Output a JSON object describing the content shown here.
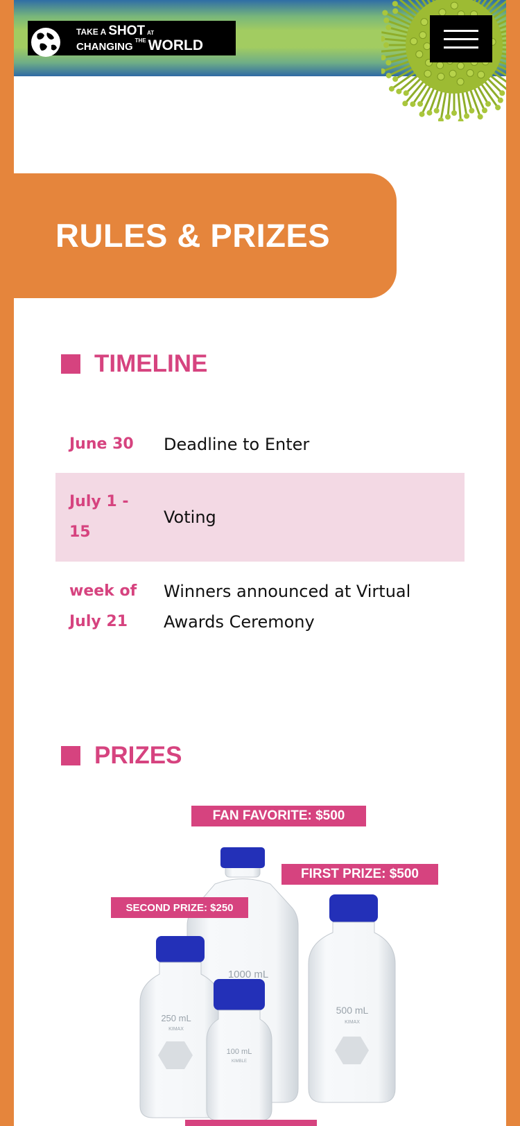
{
  "header": {
    "logo_line1_small": "TAKE A",
    "logo_line1_big": "SHOT",
    "logo_line1_tiny": "AT",
    "logo_line2_med": "CHANGING",
    "logo_line2_tiny": "THE",
    "logo_line2_big": "WORLD"
  },
  "page_title": "RULES & PRIZES",
  "timeline": {
    "heading": "TIMELINE",
    "rows": [
      {
        "date": "June 30",
        "event": "Deadline to Enter"
      },
      {
        "date": "July 1 - 15",
        "event": "Voting"
      },
      {
        "date": "week of July 21",
        "event": "Winners announced at Virtual Awards Ceremony"
      }
    ]
  },
  "prizes": {
    "heading": "PRIZES",
    "labels": {
      "fan_favorite": "FAN FAVORITE: $500",
      "first_prize": "FIRST PRIZE: $500",
      "second_prize": "SECOND PRIZE: $250"
    },
    "bottles": {
      "b1000": "1000 mL",
      "b500": "500 mL",
      "b250": "250 mL",
      "b100": "100 mL",
      "brand": "KIMAX",
      "sub": "KIMBLE"
    }
  },
  "colors": {
    "orange": "#e5853c",
    "pink": "#d6437f",
    "pink_light": "#f3d9e4",
    "cap_blue": "#2330b8"
  }
}
